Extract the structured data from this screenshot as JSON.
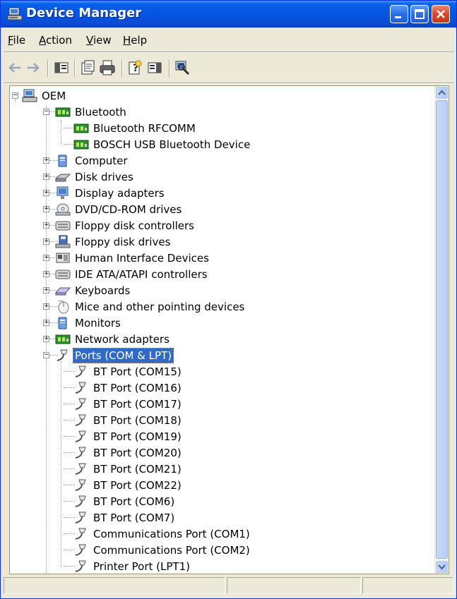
{
  "window": {
    "title": "Device Manager",
    "buttons": {
      "minimize": "minimize",
      "maximize": "maximize",
      "close": "close"
    }
  },
  "menu": [
    {
      "label": "File",
      "access": "F"
    },
    {
      "label": "Action",
      "access": "A"
    },
    {
      "label": "View",
      "access": "V"
    },
    {
      "label": "Help",
      "access": "H"
    }
  ],
  "toolbar": {
    "icons": [
      "back-arrow-icon",
      "forward-arrow-icon",
      "show-hide-console-tree-icon",
      "properties-icon",
      "print-icon",
      "help-icon",
      "show-hide-action-pane-icon",
      "scan-hardware-changes-icon"
    ]
  },
  "tree": {
    "root": "OEM",
    "bluetooth": {
      "label": "Bluetooth",
      "children": [
        "Bluetooth RFCOMM",
        "BOSCH USB Bluetooth Device"
      ]
    },
    "categories": [
      {
        "label": "Computer",
        "icon": "computer-icon"
      },
      {
        "label": "Disk drives",
        "icon": "disk-drive-icon"
      },
      {
        "label": "Display adapters",
        "icon": "display-adapter-icon"
      },
      {
        "label": "DVD/CD-ROM drives",
        "icon": "cdrom-icon"
      },
      {
        "label": "Floppy disk controllers",
        "icon": "floppy-controller-icon"
      },
      {
        "label": "Floppy disk drives",
        "icon": "floppy-drive-icon"
      },
      {
        "label": "Human Interface Devices",
        "icon": "hid-icon"
      },
      {
        "label": "IDE ATA/ATAPI controllers",
        "icon": "ide-controller-icon"
      },
      {
        "label": "Keyboards",
        "icon": "keyboard-icon"
      },
      {
        "label": "Mice and other pointing devices",
        "icon": "mouse-icon"
      },
      {
        "label": "Monitors",
        "icon": "monitor-icon"
      },
      {
        "label": "Network adapters",
        "icon": "network-adapter-icon"
      }
    ],
    "ports": {
      "label": "Ports (COM & LPT)",
      "children": [
        "BT Port (COM15)",
        "BT Port (COM16)",
        "BT Port (COM17)",
        "BT Port (COM18)",
        "BT Port (COM19)",
        "BT Port (COM20)",
        "BT Port (COM21)",
        "BT Port (COM22)",
        "BT Port (COM6)",
        "BT Port (COM7)",
        "Communications Port (COM1)",
        "Communications Port (COM2)",
        "Printer Port (LPT1)"
      ]
    }
  },
  "colors": {
    "selection": "#316ac5",
    "titlebar": "#0554e0",
    "close_button": "#d7492a"
  }
}
